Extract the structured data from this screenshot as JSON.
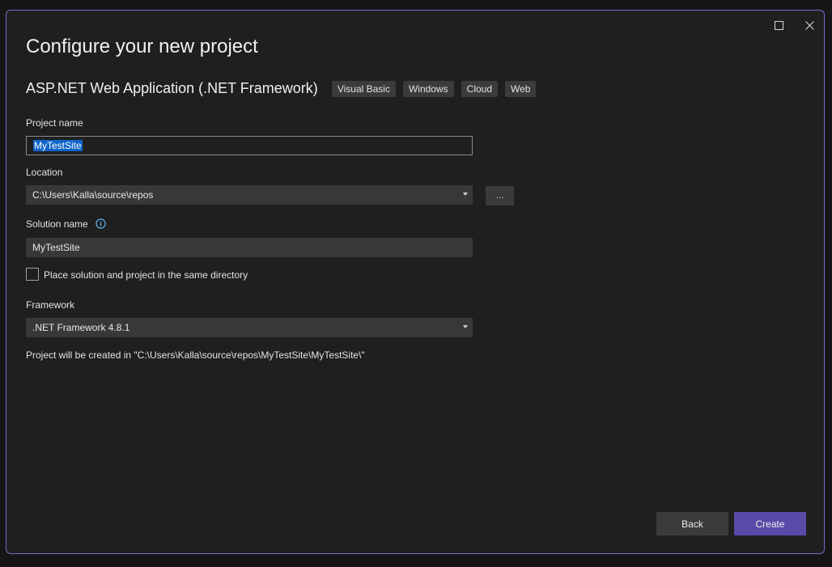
{
  "dialog": {
    "title": "Configure your new project",
    "template_name": "ASP.NET Web Application (.NET Framework)",
    "tags": [
      "Visual Basic",
      "Windows",
      "Cloud",
      "Web"
    ]
  },
  "form": {
    "project_name_label": "Project name",
    "project_name_value": "MyTestSite",
    "location_label": "Location",
    "location_value": "C:\\Users\\Kalla\\source\\repos",
    "browse_label": "...",
    "solution_name_label": "Solution name",
    "solution_name_value": "MyTestSite",
    "same_directory_label": "Place solution and project in the same directory",
    "same_directory_checked": false,
    "framework_label": "Framework",
    "framework_value": ".NET Framework 4.8.1",
    "path_note": "Project will be created in \"C:\\Users\\Kalla\\source\\repos\\MyTestSite\\MyTestSite\\\""
  },
  "footer": {
    "back_label": "Back",
    "create_label": "Create"
  },
  "colors": {
    "accent": "#7b6ac8",
    "create_button": "#5a4aa8",
    "selection": "#0e64c8",
    "info_icon": "#5fb4ee"
  },
  "icons": {
    "maximize": "maximize-icon",
    "close": "close-icon",
    "info": "info-icon",
    "dropdown": "chevron-down-icon"
  }
}
